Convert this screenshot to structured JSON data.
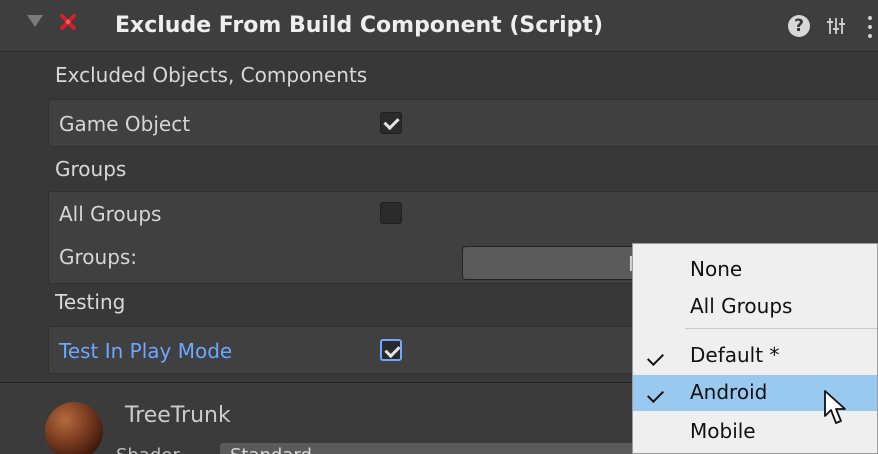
{
  "component": {
    "title": "Exclude From Build Component (Script)",
    "icons": {
      "fold": "triangle-down-icon",
      "status": "x-icon",
      "help": "help-icon",
      "presets": "presets-icon",
      "menu": "kebab-menu-icon"
    }
  },
  "sections": {
    "excluded": {
      "label": "Excluded Objects, Components",
      "game_object_label": "Game Object",
      "game_object_checked": true
    },
    "groups": {
      "label": "Groups",
      "all_groups_label": "All Groups",
      "all_groups_checked": false,
      "groups_label": "Groups:",
      "groups_value": "M"
    },
    "testing": {
      "label": "Testing",
      "test_in_play_mode_label": "Test In Play Mode",
      "test_in_play_mode_checked": true
    }
  },
  "material": {
    "name": "TreeTrunk",
    "shader_label": "Shader",
    "shader_value": "Standard"
  },
  "popup": {
    "items": [
      {
        "label": "None",
        "checked": false,
        "hovered": false
      },
      {
        "label": "All Groups",
        "checked": false,
        "hovered": false
      },
      {
        "label": "Default *",
        "checked": true,
        "hovered": false
      },
      {
        "label": "Android",
        "checked": true,
        "hovered": true
      },
      {
        "label": "Mobile",
        "checked": false,
        "hovered": false
      }
    ]
  },
  "colors": {
    "background": "#383838",
    "header": "#3e3e3e",
    "field_box": "#404040",
    "popup_bg": "#efefef",
    "popup_highlight": "#99c9ef",
    "accent_blue": "#6fa6ff",
    "red_icon": "#d11f2f"
  }
}
